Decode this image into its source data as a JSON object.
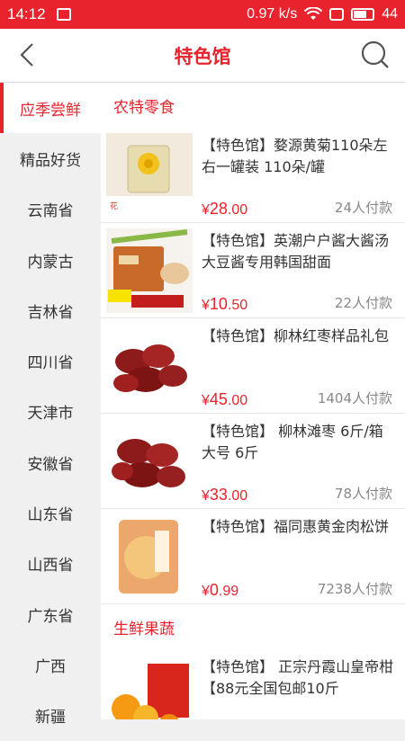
{
  "status": {
    "time": "14:12",
    "speed": "0.97 k/s",
    "battery": "44"
  },
  "header": {
    "title": "特色馆",
    "back_icon": "back-arrow-icon",
    "search_icon": "search-icon"
  },
  "sidebar": {
    "items": [
      {
        "label": "应季尝鲜",
        "active": true
      },
      {
        "label": "精品好货"
      },
      {
        "label": "云南省"
      },
      {
        "label": "内蒙古"
      },
      {
        "label": "吉林省"
      },
      {
        "label": "四川省"
      },
      {
        "label": "天津市"
      },
      {
        "label": "安徽省"
      },
      {
        "label": "山东省"
      },
      {
        "label": "山西省"
      },
      {
        "label": "广东省"
      },
      {
        "label": "广西"
      },
      {
        "label": "新疆"
      }
    ]
  },
  "sections": [
    {
      "title": "农特零食",
      "products": [
        {
          "name": "【特色馆】婺源黄菊110朵左右一罐装 110朵/罐",
          "currency": "¥",
          "price_int": "28",
          "price_dec": ".00",
          "sold": "24人付款"
        },
        {
          "name": "【特色馆】英潮户户酱大酱汤大豆酱专用韩国甜面",
          "currency": "¥",
          "price_int": "10",
          "price_dec": ".50",
          "sold": "22人付款"
        },
        {
          "name": "【特色馆】柳林红枣样品礼包",
          "currency": "¥",
          "price_int": "45",
          "price_dec": ".00",
          "sold": "1404人付款"
        },
        {
          "name": "【特色馆】 柳林滩枣 6斤/箱 大号 6斤",
          "currency": "¥",
          "price_int": "33",
          "price_dec": ".00",
          "sold": "78人付款"
        },
        {
          "name": "【特色馆】福同惠黄金肉松饼",
          "currency": "¥",
          "price_int": "0",
          "price_dec": ".99",
          "sold": "7238人付款"
        }
      ]
    },
    {
      "title": "生鲜果蔬",
      "products": [
        {
          "name": "【特色馆】 正宗丹霞山皇帝柑【88元全国包邮10斤",
          "currency": "",
          "price_int": "",
          "price_dec": "",
          "sold": ""
        }
      ]
    }
  ],
  "colors": {
    "accent": "#e8232d"
  }
}
